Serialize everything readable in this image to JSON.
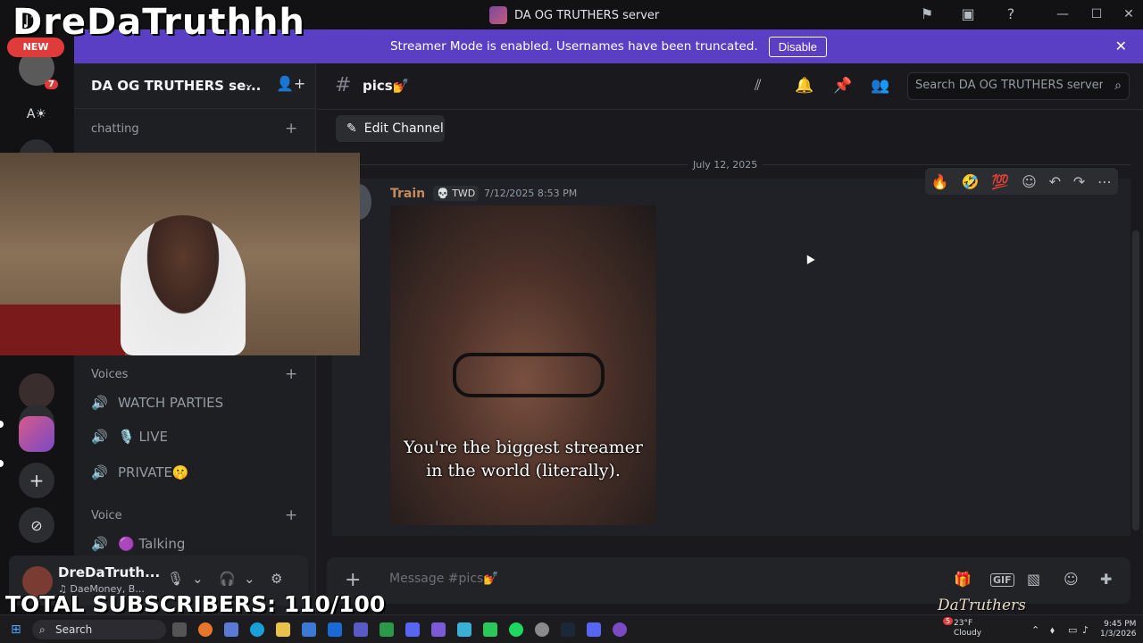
{
  "overlay": {
    "streamer_name": "DreDaTruthhh",
    "new_badge": "NEW",
    "subscribers": "TOTAL SUBSCRIBERS: 110/100"
  },
  "window": {
    "title": "DA OG TRUTHERS server"
  },
  "banner": {
    "text": "Streamer Mode is enabled. Usernames have been truncated.",
    "button": "Disable"
  },
  "servers": {
    "badge_count": "7",
    "letter_server": "A☀"
  },
  "sidebar": {
    "server_name": "DA OG TRUTHERS se...",
    "categories": {
      "chatting": "chatting",
      "voices": "Voices",
      "voice": "Voice"
    },
    "voice_channels": [
      {
        "label": "WATCH PARTIES"
      },
      {
        "label": "🎙️ LIVE"
      },
      {
        "label": "PRIVATE🤫"
      },
      {
        "label": "🟣 Talking"
      }
    ]
  },
  "user_panel": {
    "name": "DreDaTruth...",
    "status": "♫ DaeMoney, B..."
  },
  "channel_header": {
    "channel_name": "pics💅",
    "search_placeholder": "Search DA OG TRUTHERS server"
  },
  "messages": {
    "edit_channel": "Edit Channel",
    "date_divider": "July 12, 2025",
    "items": [
      {
        "author": "Train",
        "tag": "💀 TWD",
        "timestamp": "7/12/2025 8:53 PM",
        "image_caption_line1": "You're the biggest streamer",
        "image_caption_line2": "in the world (literally)."
      }
    ],
    "reactions": [
      "🔥",
      "🤣",
      "💯"
    ]
  },
  "composer": {
    "placeholder": "Message #pics💅"
  },
  "watermark": "DaTruthers",
  "taskbar": {
    "search": "Search",
    "weather_temp": "23°F",
    "weather_desc": "Cloudy",
    "time": "9:45 PM",
    "date": "1/3/2026",
    "weather_badge": "5"
  }
}
